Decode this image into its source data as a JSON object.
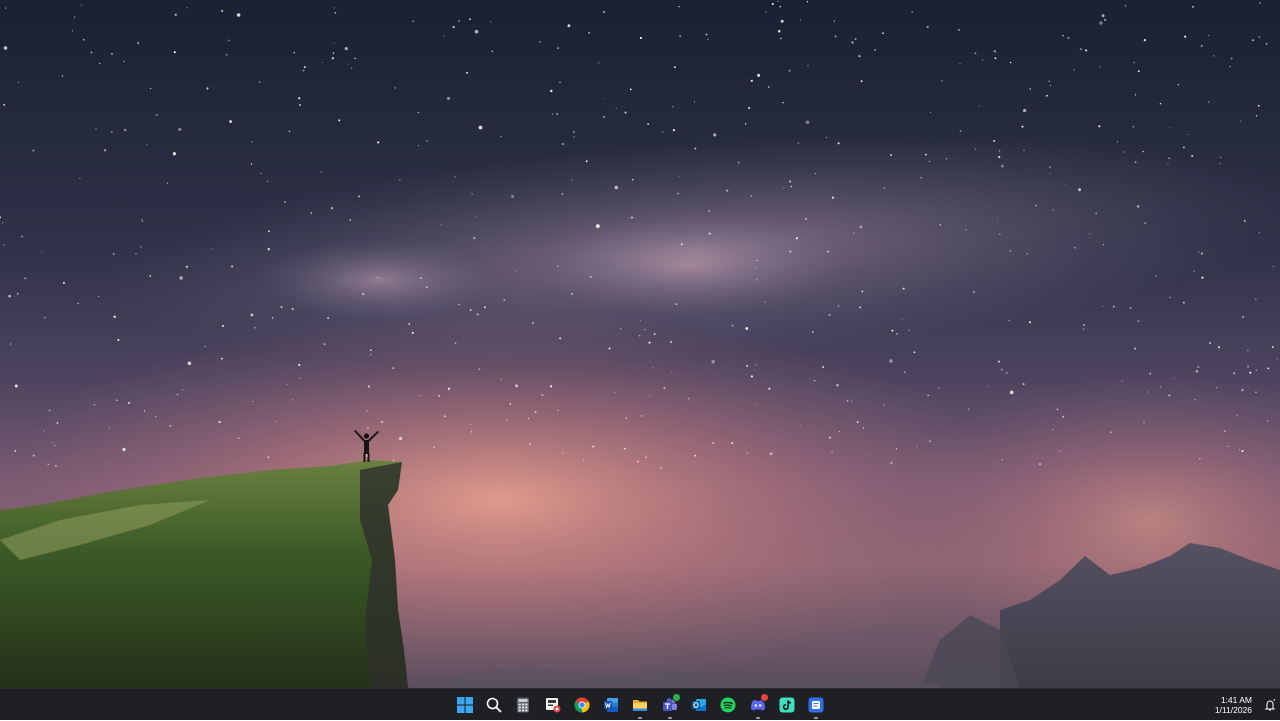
{
  "desktop": {
    "wallpaper": "milky-way-over-cliff",
    "colors": {
      "sky_top": "#1c2334",
      "sky_mid": "#574a63",
      "horizon_glow": "#e8968a",
      "cliff": "#3f5a2a",
      "mountains": "#4a4650"
    }
  },
  "taskbar": {
    "background": "#1f2023",
    "icons": [
      {
        "icon": "windows-start-icon",
        "running": false
      },
      {
        "icon": "search-icon",
        "running": false
      },
      {
        "icon": "calculator-icon",
        "running": false
      },
      {
        "icon": "snipping-tool-icon",
        "running": false
      },
      {
        "icon": "chrome-icon",
        "running": false
      },
      {
        "icon": "word-icon",
        "running": false
      },
      {
        "icon": "file-explorer-icon",
        "running": true
      },
      {
        "icon": "teams-icon",
        "running": true,
        "badge": "#2ab34a"
      },
      {
        "icon": "outlook-icon",
        "running": false
      },
      {
        "icon": "spotify-icon",
        "running": false
      },
      {
        "icon": "discord-icon",
        "running": true,
        "badge": "#e8443a"
      },
      {
        "icon": "tiktok-icon",
        "running": false
      },
      {
        "icon": "notes-app-icon",
        "running": true
      }
    ],
    "clock": {
      "time": "1:41 AM",
      "date": "1/11/2026"
    },
    "notification_icon": "notification-bell-icon"
  }
}
